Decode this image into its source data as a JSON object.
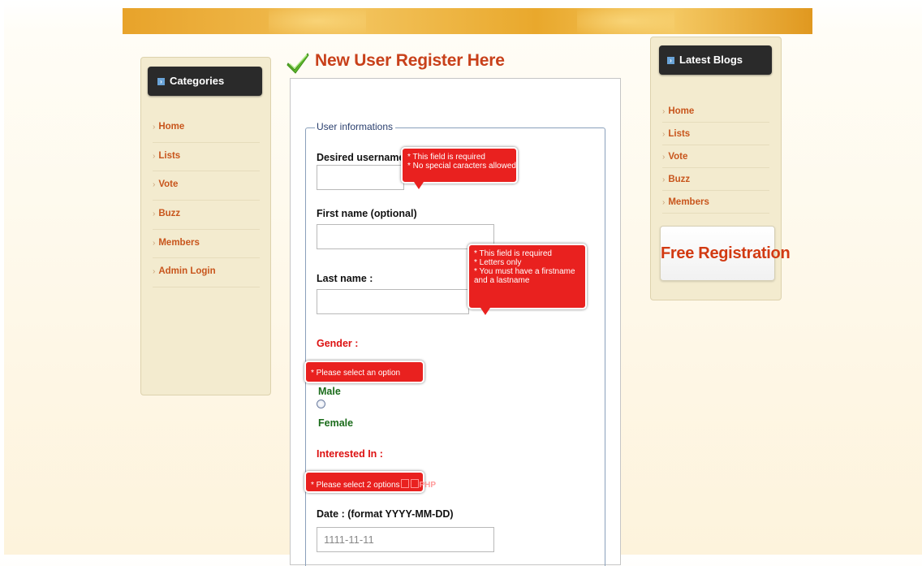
{
  "colors": {
    "accent": "#c8401a",
    "error": "#e9211f",
    "header": "#e8a32a",
    "nav_link": "#c8551c"
  },
  "left_sidebar": {
    "header": "Categories",
    "header_icon": "arrow-square-icon",
    "items": [
      "Home",
      "Lists",
      "Vote",
      "Buzz",
      "Members",
      "Admin Login"
    ]
  },
  "right_sidebar": {
    "header": "Latest Blogs",
    "header_icon": "arrow-square-icon",
    "items": [
      "Home",
      "Lists",
      "Vote",
      "Buzz",
      "Members"
    ],
    "free_registration": "Free Registration"
  },
  "main": {
    "title": "New User Register Here",
    "title_icon": "checkmark-icon",
    "fieldset_legend": "User informations",
    "fields": {
      "username_label": "Desired username :",
      "firstname_label": "First name (optional)",
      "lastname_label": "Last name :",
      "gender_label": "Gender :",
      "gender_options": [
        "Male",
        "Female"
      ],
      "interest_label": "Interested In :",
      "date_label": "Date : (format YYYY-MM-DD)",
      "date_value": "1111-11-11"
    },
    "errors": {
      "username": [
        "* This field is required",
        "* No special caracters allowed"
      ],
      "lastname": [
        "* This field is required",
        "* Letters only",
        "* You must have a firstname",
        "and a lastname"
      ],
      "gender": "* Please select an option",
      "interest": "* Please select 2 options",
      "interest_hidden_option": "PHP"
    }
  }
}
